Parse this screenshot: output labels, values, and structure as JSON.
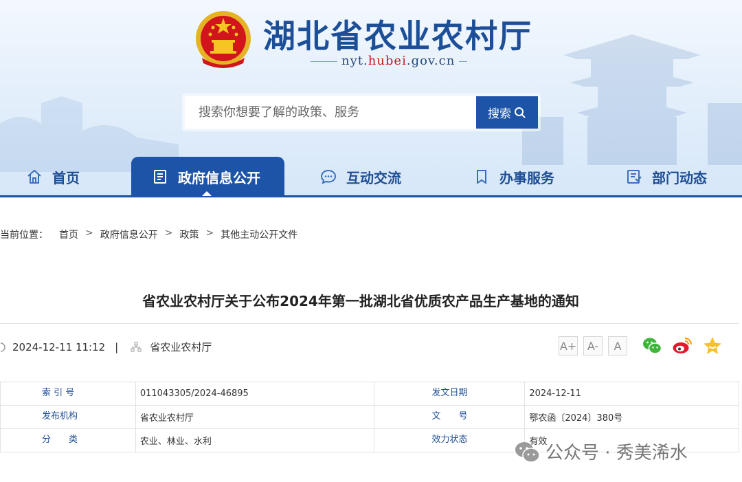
{
  "header": {
    "site_title": "湖北省农业农村厅",
    "domain_prefix": "nyt.",
    "domain_mid": "hubei",
    "domain_suffix": ".gov.cn"
  },
  "search": {
    "placeholder": "搜索你想要了解的政策、服务",
    "button_label": "搜索"
  },
  "nav": {
    "items": [
      {
        "label": "首页",
        "icon": "home-icon"
      },
      {
        "label": "政府信息公开",
        "icon": "document-list-icon",
        "active": true
      },
      {
        "label": "互动交流",
        "icon": "chat-bubble-icon"
      },
      {
        "label": "办事服务",
        "icon": "bookmark-icon"
      },
      {
        "label": "部门动态",
        "icon": "report-icon"
      }
    ]
  },
  "breadcrumb": {
    "prefix": "当前位置：",
    "items": [
      "首页",
      "政府信息公开",
      "政策",
      "其他主动公开文件"
    ],
    "separator": ">"
  },
  "article": {
    "title": "省农业农村厅关于公布2024年第一批湖北省优质农产品生产基地的通知",
    "datetime": "2024-12-11 11:12",
    "divider": "|",
    "publisher": "省农业农村厅"
  },
  "font_controls": [
    "A+",
    "A-",
    "A"
  ],
  "share": [
    "wechat-icon",
    "weibo-icon",
    "favorite-star-icon"
  ],
  "info_table": {
    "rows": [
      {
        "label1": "索 引 号",
        "value1": "011043305/2024-46895",
        "label2": "发文日期",
        "value2": "2024-12-11"
      },
      {
        "label1": "发布机构",
        "value1": "省农业农村厅",
        "label2": "文　　号",
        "value2": "鄂农函〔2024〕380号"
      },
      {
        "label1": "分　　类",
        "value1": "农业、林业、水利",
        "label2": "效力状态",
        "value2": "有效"
      }
    ]
  },
  "watermark": "公众号 · 秀美浠水",
  "colors": {
    "brand_blue": "#1e54a8",
    "title_blue": "#1c4f98",
    "emblem_red": "#d2141c",
    "emblem_gold": "#f5c521"
  }
}
